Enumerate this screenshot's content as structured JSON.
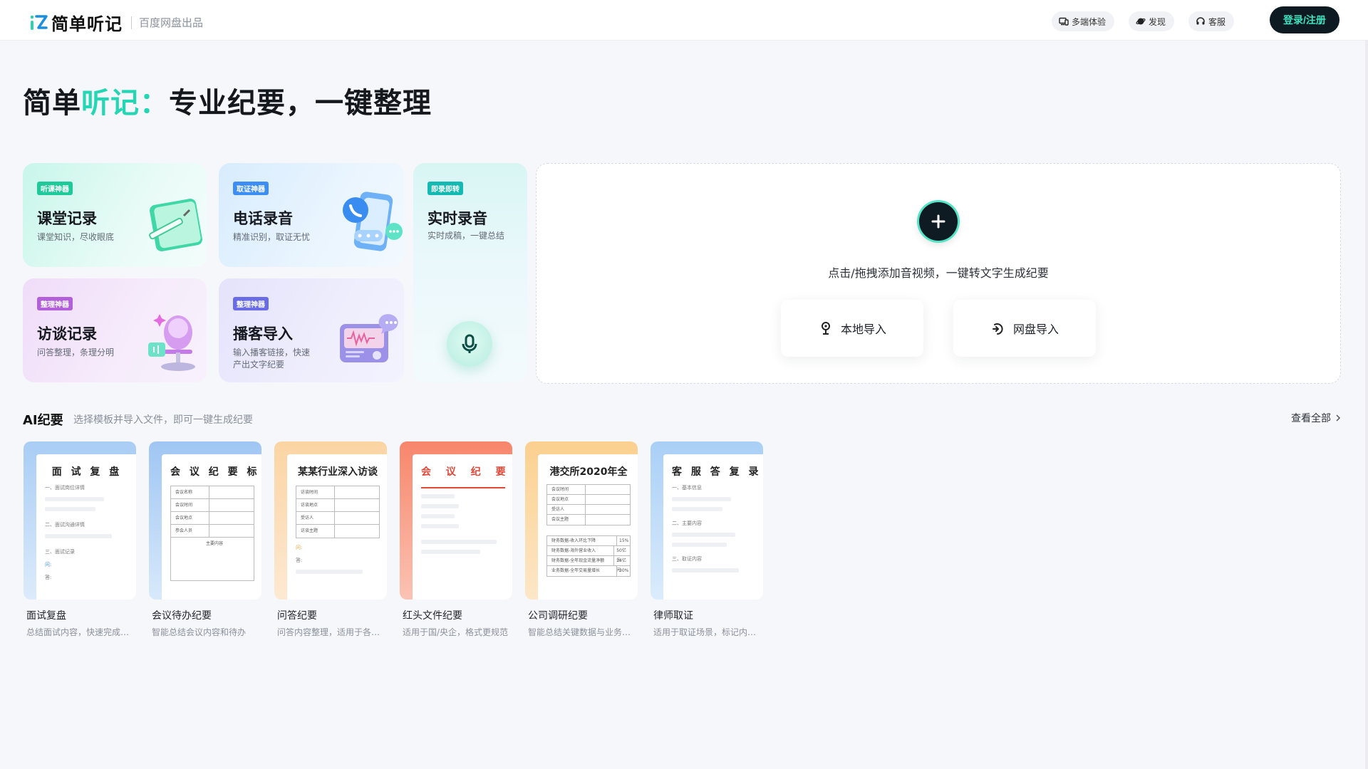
{
  "header": {
    "logo_text": "简单听记",
    "logo_sub": "百度网盘出品",
    "multi_device": "多端体验",
    "discover": "发现",
    "support": "客服",
    "login": "登录/注册"
  },
  "hero": {
    "part1": "简单",
    "part2": "听记：",
    "part3": "专业纪要，一键整理"
  },
  "features": [
    {
      "badge": "听课神器",
      "title": "课堂记录",
      "desc": "课堂知识，尽收眼底"
    },
    {
      "badge": "取证神器",
      "title": "电话录音",
      "desc": "精准识别，取证无忧"
    },
    {
      "badge": "即录即转",
      "title": "实时录音",
      "desc": "实时成稿，一键总结"
    },
    {
      "badge": "整理神器",
      "title": "访谈记录",
      "desc": "问答整理，条理分明"
    },
    {
      "badge": "整理神器",
      "title": "播客导入",
      "desc_line1": "输入播客链接，快速",
      "desc_line2": "产出文字纪要"
    }
  ],
  "upload": {
    "hint": "点击/拖拽添加音视频，一键转文字生成纪要",
    "local": "本地导入",
    "netdisk": "网盘导入"
  },
  "ai_section": {
    "title": "AI纪要",
    "subtitle": "选择模板并导入文件，即可一键生成纪要",
    "view_all": "查看全部"
  },
  "templates": [
    {
      "thumb_title": "面 试 复 盘",
      "name": "面试复盘",
      "desc": "总结面试内容，快速完成复盘",
      "s1": "一、面试岗位详情",
      "s2": "二、面试沟通详情",
      "s3": "三、面试记录",
      "q": "问:",
      "a": "答:"
    },
    {
      "thumb_title": "会 议 纪 要 标 准",
      "name": "会议待办纪要",
      "desc": "智能总结会议内容和待办",
      "rows": [
        "会议名称",
        "会议时间",
        "会议地点",
        "参会人员"
      ],
      "note": "主要内容"
    },
    {
      "thumb_title": "某某行业深入访谈",
      "name": "问答纪要",
      "desc": "问答内容整理，适用于各类...",
      "rows": [
        "访谈时间",
        "访谈地点",
        "受访人",
        "访谈主题"
      ],
      "q": "问:",
      "a": "答:"
    },
    {
      "thumb_title": "会 议 纪 要",
      "name": "红头文件纪要",
      "desc": "适用于国/央企，格式更规范"
    },
    {
      "thumb_title": "港交所2020年全",
      "name": "公司调研纪要",
      "desc": "智能总结关键数据与业务信息",
      "rows": [
        "会议时间",
        "会议地点",
        "受访人",
        "会议主题"
      ],
      "data_rows": [
        [
          "财务数据-收入环比下降",
          "15%"
        ],
        [
          "财务数据-海外营业收入",
          "50亿元"
        ],
        [
          "财务数据-全年现金流量净额",
          "14亿元"
        ],
        [
          "业务数据-全年交易量增长",
          "30%"
        ]
      ]
    },
    {
      "thumb_title": "客 服 答 复 录",
      "name": "律师取证",
      "desc": "适用于取证场景，标记内容...",
      "s1": "一、基本信息",
      "s2": "二、主要内容",
      "s3": "三、取证内容"
    }
  ],
  "colors": {
    "accent": "#24d6b3",
    "login_bg": "#0d1a22",
    "login_text": "#3ee2bf"
  }
}
